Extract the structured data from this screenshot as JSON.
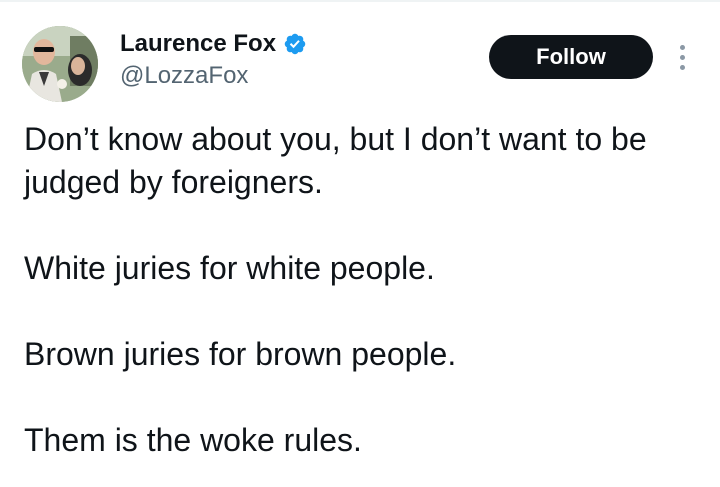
{
  "author": {
    "display_name": "Laurence Fox",
    "handle": "@LozzaFox",
    "verified": true,
    "verified_color": "#1d9bf0"
  },
  "actions": {
    "follow_label": "Follow",
    "more_icon": "more-options-icon"
  },
  "tweet": {
    "paragraphs": [
      "Don’t know about you, but I don’t want to be judged by foreigners.",
      "White juries for white people.",
      "Brown juries for brown people.",
      "Them is the woke rules."
    ]
  },
  "colors": {
    "text_primary": "#0f1419",
    "text_secondary": "#536471",
    "button_bg": "#0f1419",
    "button_text": "#ffffff"
  }
}
